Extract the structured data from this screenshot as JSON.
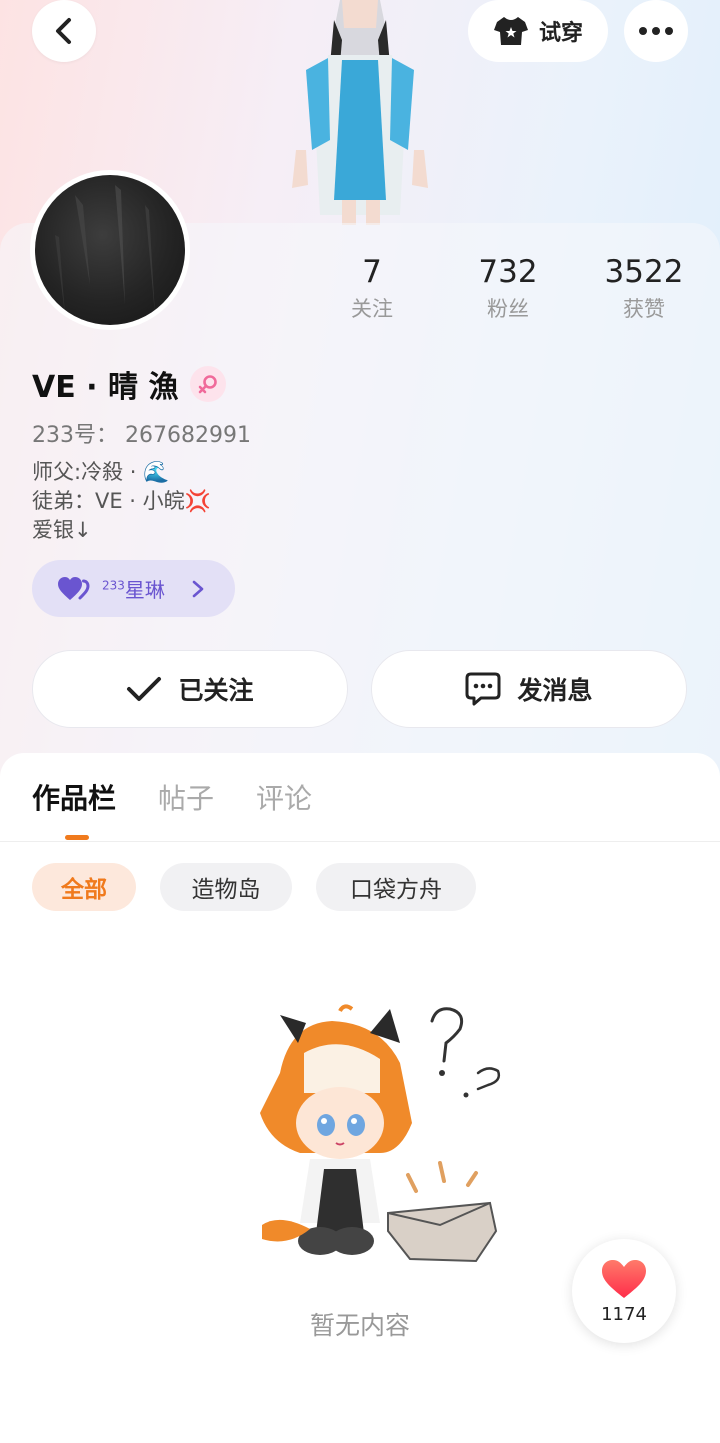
{
  "header": {
    "try_on_label": "试穿"
  },
  "stats": [
    {
      "num": "7",
      "label": "关注"
    },
    {
      "num": "732",
      "label": "粉丝"
    },
    {
      "num": "3522",
      "label": "获赞"
    }
  ],
  "profile": {
    "name": "VE · 晴 漁",
    "uid": "233号：  267682991",
    "bio": [
      "师父:冷殺 · 🌊",
      "徒弟：VE · 小皖💢",
      "爱银↓"
    ],
    "badge": {
      "sup": "233",
      "label": "星琳"
    }
  },
  "actions": {
    "follow_label": "已关注",
    "message_label": "发消息"
  },
  "tabs": [
    "作品栏",
    "帖子",
    "评论"
  ],
  "chips": [
    "全部",
    "造物岛",
    "口袋方舟"
  ],
  "empty_text": "暂无内容",
  "likes": "1174",
  "colors": {
    "accent": "#f07a1d",
    "badge": "#6a55d0",
    "heart": "#ff3b4e"
  }
}
